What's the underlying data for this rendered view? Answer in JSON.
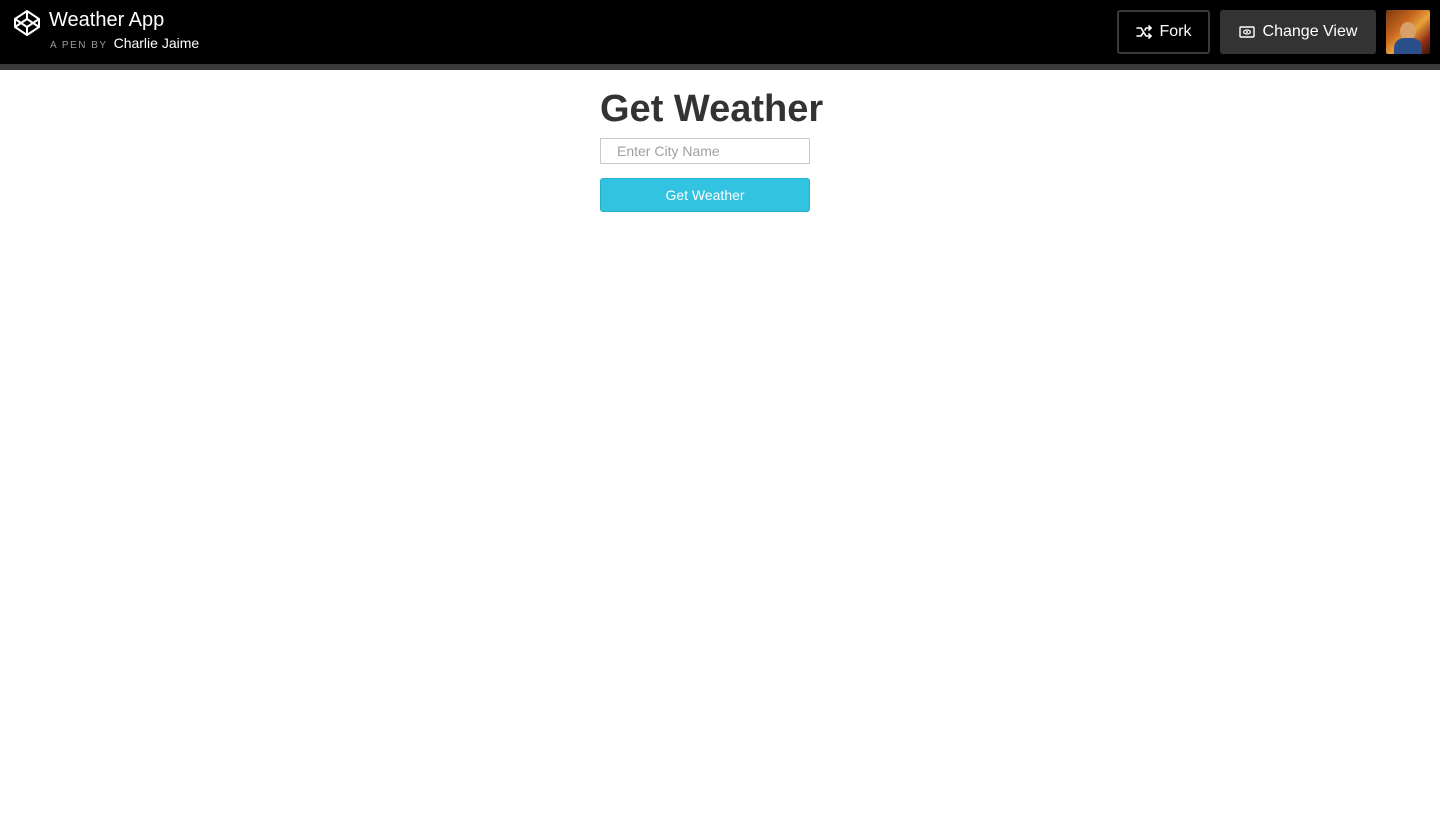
{
  "header": {
    "logo_icon": "codepen-logo-icon",
    "title": "Weather App",
    "byline_prefix": "A PEN BY",
    "author": "Charlie Jaime",
    "fork_label": "Fork",
    "fork_icon": "fork-icon",
    "change_view_label": "Change View",
    "change_view_icon": "eye-icon",
    "avatar": "user-avatar"
  },
  "main": {
    "heading": "Get Weather",
    "city_input": {
      "value": "",
      "placeholder": "Enter City Name"
    },
    "submit_label": "Get Weather"
  },
  "colors": {
    "topbar": "#000000",
    "accent_button": "#31c3e0",
    "heading_text": "#333333"
  }
}
